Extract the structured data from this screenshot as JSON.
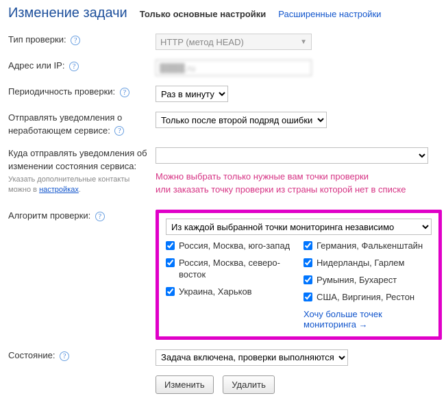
{
  "header": {
    "title": "Изменение задачи",
    "tab_basic": "Только основные настройки",
    "tab_advanced": "Расширенные настройки"
  },
  "labels": {
    "check_type": "Тип проверки:",
    "address": "Адрес или IP:",
    "interval": "Периодичность проверки:",
    "notify_down": "Отправлять уведомления о неработающем сервисе:",
    "notify_where": "Куда отправлять уведомления об изменении состояния сервиса:",
    "notify_hint_pre": "Указать дополнительные контакты можно в ",
    "notify_hint_link": "настройках",
    "notify_hint_post": ".",
    "algorithm": "Алгоритм проверки:",
    "state": "Состояние:"
  },
  "callout": {
    "line1": "Можно выбрать только нужные вам точки проверки",
    "line2": "или заказать точку проверки из страны которой нет в списке"
  },
  "fields": {
    "check_type_value": "HTTP (метод HEAD)",
    "address_value": "████.ru",
    "interval_value": "Раз в минуту",
    "notify_down_value": "Только после второй подряд ошибки",
    "notify_where_value": "",
    "algorithm_value": "Из каждой выбранной точки мониторинга независимо",
    "state_value": "Задача включена, проверки выполняются"
  },
  "check_points": [
    {
      "label": "Россия, Москва, юго-запад",
      "checked": true
    },
    {
      "label": "Россия, Москва, северо-восток",
      "checked": true
    },
    {
      "label": "Украина, Харьков",
      "checked": true
    },
    {
      "label": "Германия, Фалькенштайн",
      "checked": true
    },
    {
      "label": "Нидерланды, Гарлем",
      "checked": true
    },
    {
      "label": "Румыния, Бухарест",
      "checked": true
    },
    {
      "label": "США, Виргиния, Рестон",
      "checked": true
    }
  ],
  "more_points_link": "Хочу больше точек мониторинга →",
  "buttons": {
    "save": "Изменить",
    "delete": "Удалить"
  },
  "colors": {
    "accent_link": "#1155cc",
    "highlight_border": "#e000c8",
    "callout_text": "#d63384"
  }
}
